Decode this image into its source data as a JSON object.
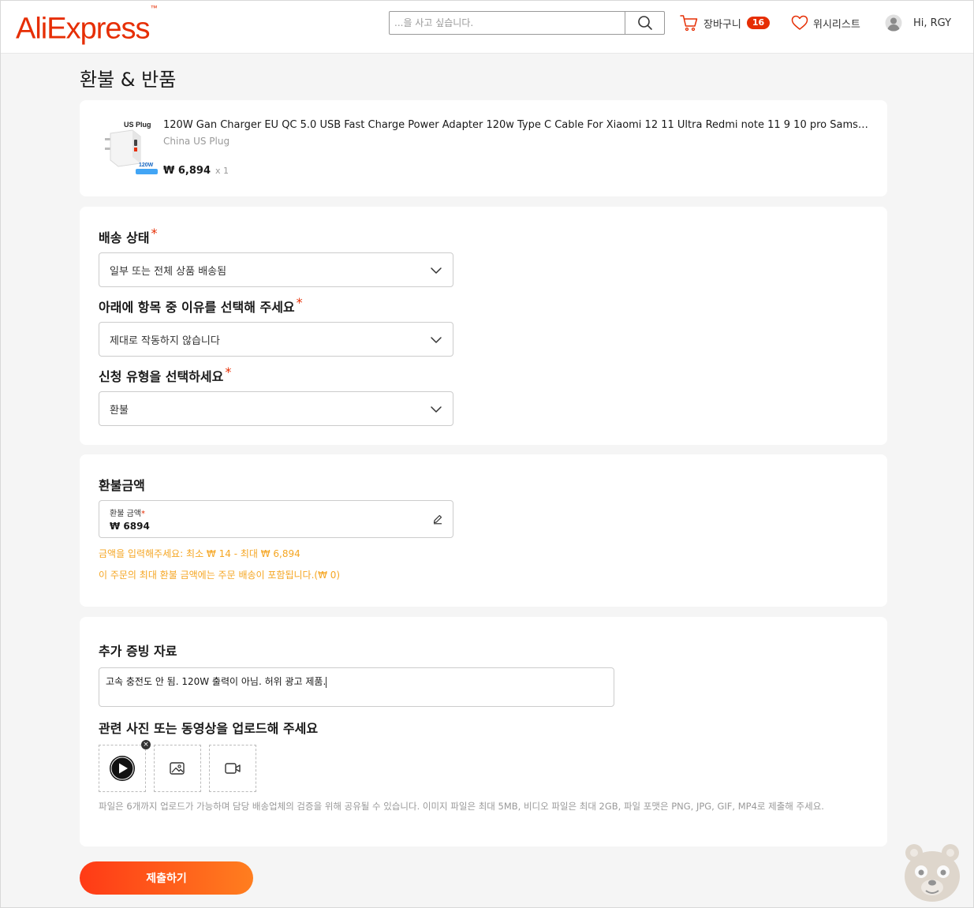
{
  "header": {
    "logo_text": "AliExpress",
    "logo_tm": "™",
    "search_placeholder": "...을 사고 싶습니다.",
    "cart_label": "장바구니",
    "cart_count": "16",
    "wishlist_label": "위시리스트",
    "user_greeting": "Hi, RGY"
  },
  "page_title": "환불 & 반품",
  "product": {
    "title": "120W Gan Charger EU QC 5.0 USB Fast Charge Power Adapter 120w Type C Cable For Xiaomi 12 11 Ultra Redmi note 11 9 10 pro Samsu...",
    "variant": "China US Plug",
    "price": "₩ 6,894",
    "quantity": "x 1",
    "image_text_top": "US Plug",
    "image_text_watt": "120W"
  },
  "delivery": {
    "status_label": "배송 상태",
    "status_value": "일부 또는 전체 상품 배송됨",
    "reason_label": "아래에 항목 중 이유를 선택해 주세요",
    "reason_value": "제대로 작동하지 않습니다",
    "type_label": "신청 유형을 선택하세요",
    "type_value": "환불",
    "required_mark": "*"
  },
  "refund": {
    "section_title": "환불금액",
    "field_label": "환불 금액",
    "required_mark": "*",
    "value": "₩ 6894",
    "hint_range": "금액을 입력해주세요: 최소 ₩ 14 - 최대 ₩ 6,894",
    "hint_shipping": "이 주문의 최대 환불 금액에는 주문 배송이 포함됩니다.(₩ 0)"
  },
  "evidence": {
    "section_title": "추가 증빙 자료",
    "text_value": "고속 충전도 안 됨. 120W 출력이 아님. 허위 광고 제품.",
    "upload_title": "관련 사진 또는 동영상을 업로드해 주세요",
    "remove_symbol": "×",
    "note": "파일은 6개까지 업로드가 가능하며 담당 배송업체의 검증을 위해 공유될 수 있습니다. 이미지 파일은 최대 5MB, 비디오 파일은 최대 2GB, 파일 포맷은 PNG, JPG, GIF, MP4로 제출해 주세요."
  },
  "submit_label": "제출하기",
  "colors": {
    "brand": "#e62e04",
    "hint": "#f5a623",
    "submit_start": "#ff3a16",
    "submit_end": "#ff7e1f"
  },
  "icons": {
    "search": "search-icon",
    "cart": "cart-icon",
    "wishlist": "heart-icon",
    "user": "user-avatar-icon",
    "select": "chevron-down-icon",
    "edit": "pencil-icon",
    "video": "play-icon",
    "add_image": "add-image-icon",
    "add_video": "add-video-icon"
  }
}
